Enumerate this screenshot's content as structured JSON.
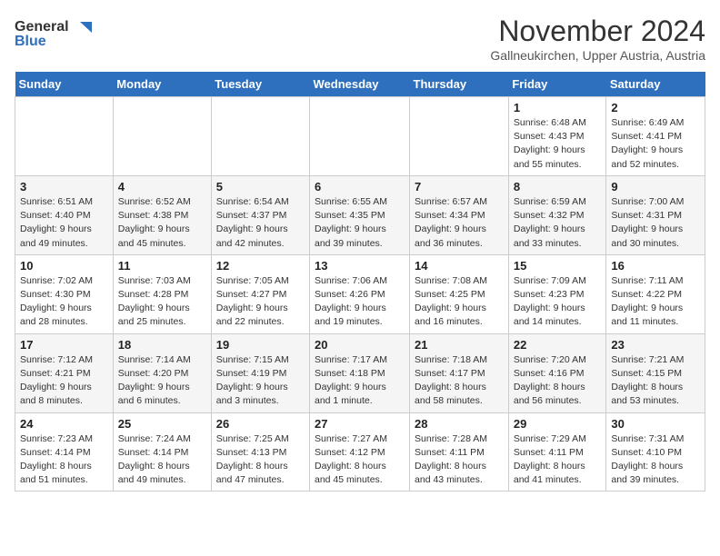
{
  "header": {
    "logo_general": "General",
    "logo_blue": "Blue",
    "month_title": "November 2024",
    "location": "Gallneukirchen, Upper Austria, Austria"
  },
  "weekdays": [
    "Sunday",
    "Monday",
    "Tuesday",
    "Wednesday",
    "Thursday",
    "Friday",
    "Saturday"
  ],
  "weeks": [
    [
      {
        "day": "",
        "info": ""
      },
      {
        "day": "",
        "info": ""
      },
      {
        "day": "",
        "info": ""
      },
      {
        "day": "",
        "info": ""
      },
      {
        "day": "",
        "info": ""
      },
      {
        "day": "1",
        "info": "Sunrise: 6:48 AM\nSunset: 4:43 PM\nDaylight: 9 hours\nand 55 minutes."
      },
      {
        "day": "2",
        "info": "Sunrise: 6:49 AM\nSunset: 4:41 PM\nDaylight: 9 hours\nand 52 minutes."
      }
    ],
    [
      {
        "day": "3",
        "info": "Sunrise: 6:51 AM\nSunset: 4:40 PM\nDaylight: 9 hours\nand 49 minutes."
      },
      {
        "day": "4",
        "info": "Sunrise: 6:52 AM\nSunset: 4:38 PM\nDaylight: 9 hours\nand 45 minutes."
      },
      {
        "day": "5",
        "info": "Sunrise: 6:54 AM\nSunset: 4:37 PM\nDaylight: 9 hours\nand 42 minutes."
      },
      {
        "day": "6",
        "info": "Sunrise: 6:55 AM\nSunset: 4:35 PM\nDaylight: 9 hours\nand 39 minutes."
      },
      {
        "day": "7",
        "info": "Sunrise: 6:57 AM\nSunset: 4:34 PM\nDaylight: 9 hours\nand 36 minutes."
      },
      {
        "day": "8",
        "info": "Sunrise: 6:59 AM\nSunset: 4:32 PM\nDaylight: 9 hours\nand 33 minutes."
      },
      {
        "day": "9",
        "info": "Sunrise: 7:00 AM\nSunset: 4:31 PM\nDaylight: 9 hours\nand 30 minutes."
      }
    ],
    [
      {
        "day": "10",
        "info": "Sunrise: 7:02 AM\nSunset: 4:30 PM\nDaylight: 9 hours\nand 28 minutes."
      },
      {
        "day": "11",
        "info": "Sunrise: 7:03 AM\nSunset: 4:28 PM\nDaylight: 9 hours\nand 25 minutes."
      },
      {
        "day": "12",
        "info": "Sunrise: 7:05 AM\nSunset: 4:27 PM\nDaylight: 9 hours\nand 22 minutes."
      },
      {
        "day": "13",
        "info": "Sunrise: 7:06 AM\nSunset: 4:26 PM\nDaylight: 9 hours\nand 19 minutes."
      },
      {
        "day": "14",
        "info": "Sunrise: 7:08 AM\nSunset: 4:25 PM\nDaylight: 9 hours\nand 16 minutes."
      },
      {
        "day": "15",
        "info": "Sunrise: 7:09 AM\nSunset: 4:23 PM\nDaylight: 9 hours\nand 14 minutes."
      },
      {
        "day": "16",
        "info": "Sunrise: 7:11 AM\nSunset: 4:22 PM\nDaylight: 9 hours\nand 11 minutes."
      }
    ],
    [
      {
        "day": "17",
        "info": "Sunrise: 7:12 AM\nSunset: 4:21 PM\nDaylight: 9 hours\nand 8 minutes."
      },
      {
        "day": "18",
        "info": "Sunrise: 7:14 AM\nSunset: 4:20 PM\nDaylight: 9 hours\nand 6 minutes."
      },
      {
        "day": "19",
        "info": "Sunrise: 7:15 AM\nSunset: 4:19 PM\nDaylight: 9 hours\nand 3 minutes."
      },
      {
        "day": "20",
        "info": "Sunrise: 7:17 AM\nSunset: 4:18 PM\nDaylight: 9 hours\nand 1 minute."
      },
      {
        "day": "21",
        "info": "Sunrise: 7:18 AM\nSunset: 4:17 PM\nDaylight: 8 hours\nand 58 minutes."
      },
      {
        "day": "22",
        "info": "Sunrise: 7:20 AM\nSunset: 4:16 PM\nDaylight: 8 hours\nand 56 minutes."
      },
      {
        "day": "23",
        "info": "Sunrise: 7:21 AM\nSunset: 4:15 PM\nDaylight: 8 hours\nand 53 minutes."
      }
    ],
    [
      {
        "day": "24",
        "info": "Sunrise: 7:23 AM\nSunset: 4:14 PM\nDaylight: 8 hours\nand 51 minutes."
      },
      {
        "day": "25",
        "info": "Sunrise: 7:24 AM\nSunset: 4:14 PM\nDaylight: 8 hours\nand 49 minutes."
      },
      {
        "day": "26",
        "info": "Sunrise: 7:25 AM\nSunset: 4:13 PM\nDaylight: 8 hours\nand 47 minutes."
      },
      {
        "day": "27",
        "info": "Sunrise: 7:27 AM\nSunset: 4:12 PM\nDaylight: 8 hours\nand 45 minutes."
      },
      {
        "day": "28",
        "info": "Sunrise: 7:28 AM\nSunset: 4:11 PM\nDaylight: 8 hours\nand 43 minutes."
      },
      {
        "day": "29",
        "info": "Sunrise: 7:29 AM\nSunset: 4:11 PM\nDaylight: 8 hours\nand 41 minutes."
      },
      {
        "day": "30",
        "info": "Sunrise: 7:31 AM\nSunset: 4:10 PM\nDaylight: 8 hours\nand 39 minutes."
      }
    ]
  ]
}
